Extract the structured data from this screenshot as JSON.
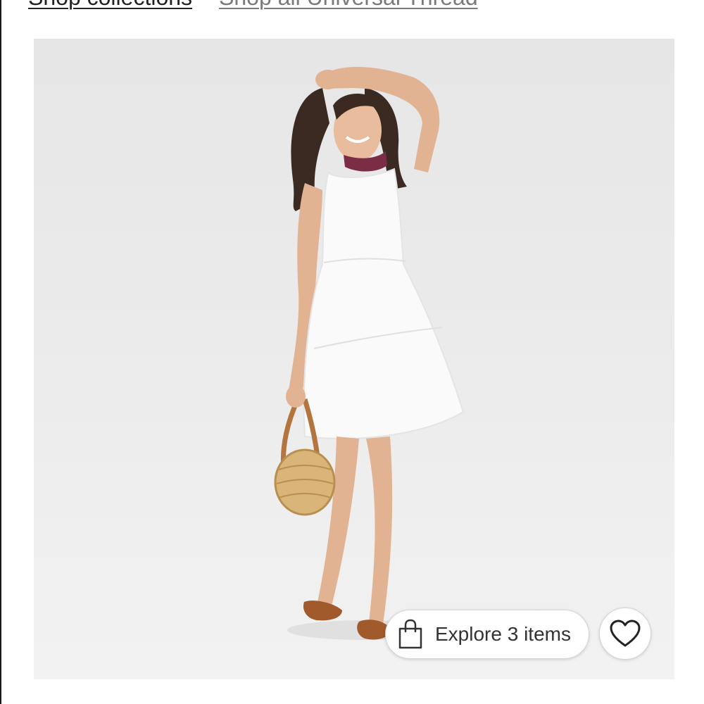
{
  "nav_links": {
    "collections": "Shop collections",
    "brand": "Shop all Universal Thread"
  },
  "product_image": {
    "subject": "Model wearing white sleeveless tiered dress with woven round bag and brown slide sandals",
    "dress_color": "#ffffff",
    "background_color": "#eaeaea"
  },
  "explore_button": {
    "label": "Explore 3 items",
    "icon": "shopping-bag-icon"
  },
  "favorite_button": {
    "icon": "heart-outline-icon"
  },
  "colors": {
    "link_primary": "#222222",
    "link_secondary": "#7a7a7a",
    "button_border": "#d4d4d4"
  }
}
